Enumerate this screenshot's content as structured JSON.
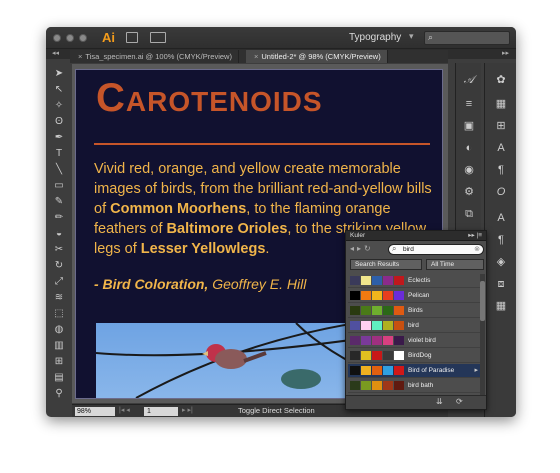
{
  "app": {
    "logo": "Ai",
    "workspace": "Typography"
  },
  "tabs": [
    {
      "label": "Tisa_specimen.ai @ 100% (CMYK/Preview)"
    },
    {
      "label": "Untitled-2* @ 98% (CMYK/Preview)"
    }
  ],
  "artboard": {
    "heading": "Carotenoids",
    "body_parts": [
      "Vivid red, orange, and yellow create memorable images of birds, from the brilliant red-and-yellow bills of ",
      "Common Moorhens",
      ", to the flaming orange feathers of ",
      "Baltimore Orioles",
      ", to the striking yellow legs of ",
      "Lesser Yellowlegs",
      "."
    ],
    "quote_bold": "- Bird Coloration,",
    "quote_rest": " Geoffrey E. Hill"
  },
  "status": {
    "zoom": "98%",
    "page": "1",
    "text": "Toggle Direct Selection"
  },
  "kuler": {
    "title": "Kuler",
    "search_value": "bird",
    "filter1": "Search Results",
    "filter2": "All Time",
    "themes": [
      {
        "name": "Eclectis",
        "colors": [
          "#3a3a5a",
          "#f0e68c",
          "#2e5fa8",
          "#8b2b8b",
          "#c0181c"
        ]
      },
      {
        "name": "Pelican",
        "colors": [
          "#000000",
          "#f07a10",
          "#f2b61c",
          "#e83e1e",
          "#6a2cd8"
        ]
      },
      {
        "name": "Birds",
        "colors": [
          "#2a3a10",
          "#4a7a18",
          "#6fae2e",
          "#2c6818",
          "#e05a12"
        ]
      },
      {
        "name": "bird",
        "colors": [
          "#5050a0",
          "#ffd0f0",
          "#60f0c0",
          "#b0b020",
          "#c85010"
        ]
      },
      {
        "name": "violet bird",
        "colors": [
          "#5a2a6a",
          "#7a3a9a",
          "#a03080",
          "#d84080",
          "#3a1a4a"
        ]
      },
      {
        "name": "BirdDog",
        "colors": [
          "#282828",
          "#e0c020",
          "#c81818",
          "#3a3a3a",
          "#ffffff"
        ]
      },
      {
        "name": "Bird of Paradise",
        "colors": [
          "#101010",
          "#f0b020",
          "#e06010",
          "#30a0e0",
          "#d01818"
        ]
      },
      {
        "name": "bird bath",
        "colors": [
          "#2a3a1a",
          "#7a9a20",
          "#e09010",
          "#a03818",
          "#601a10"
        ]
      }
    ]
  }
}
